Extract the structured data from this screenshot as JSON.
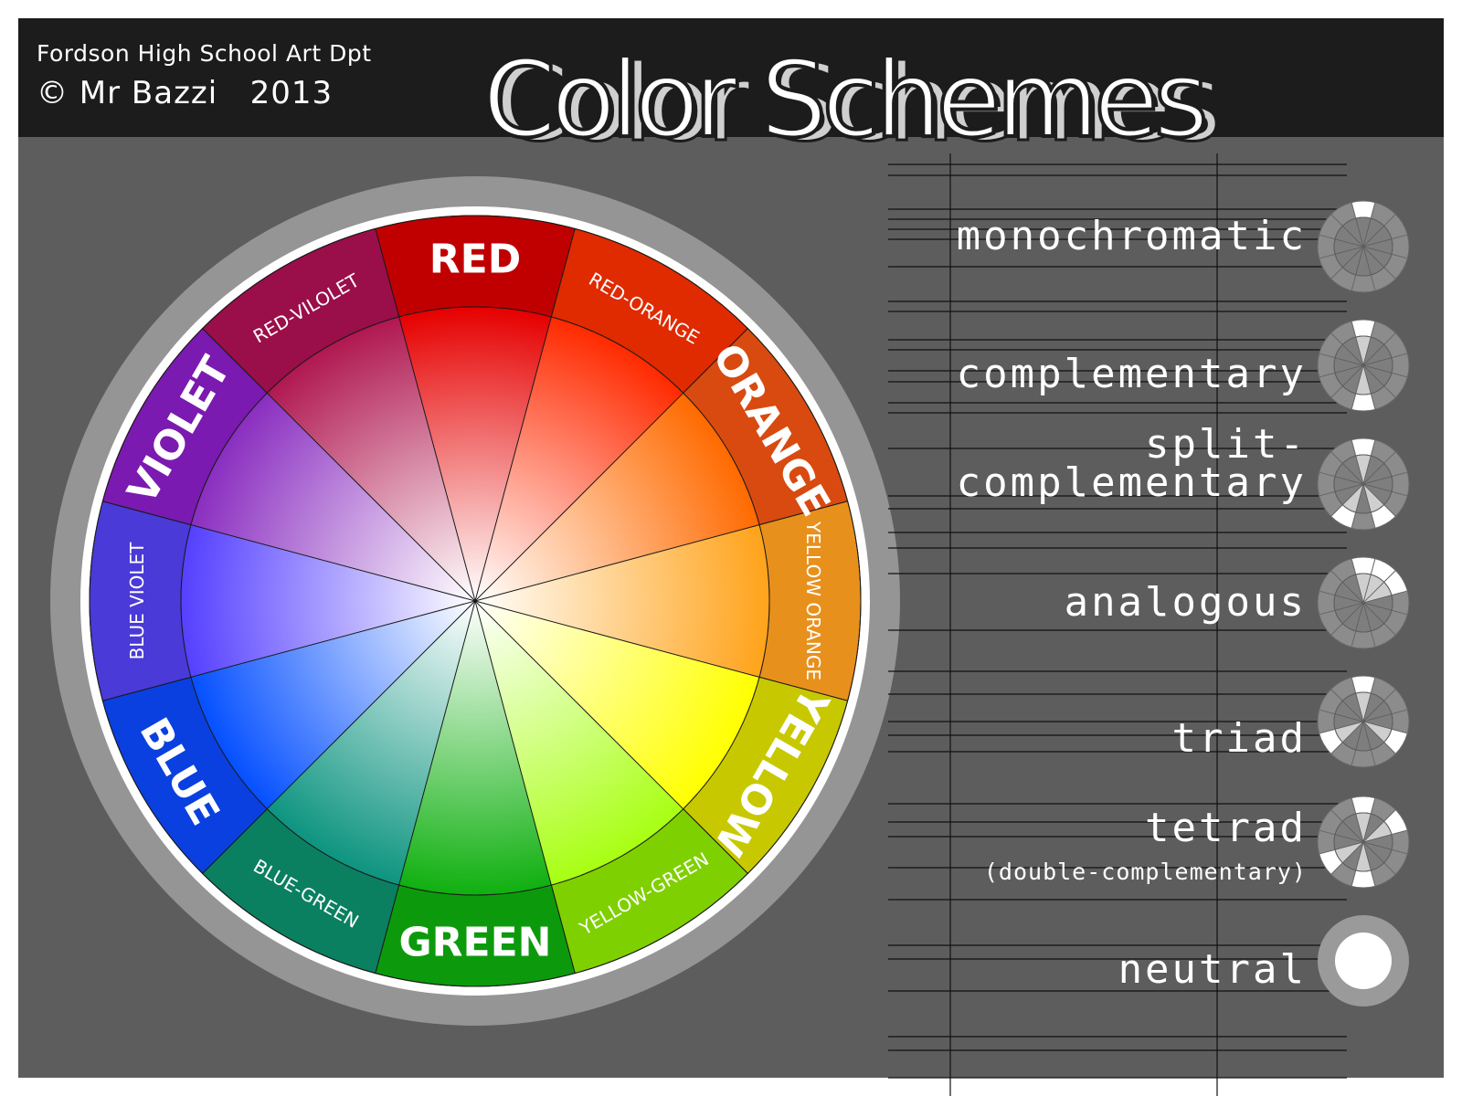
{
  "header": {
    "credit_line_1": "Fordson High School Art Dpt",
    "credit_line_2": "© Mr Bazzi   2013",
    "title": "Color Schemes"
  },
  "color_wheel": {
    "segments": [
      {
        "label": "RED",
        "primary": true,
        "ring_color": "#c00000",
        "inner_color": "#e60000"
      },
      {
        "label": "RED-ORANGE",
        "primary": false,
        "ring_color": "#e02a00",
        "inner_color": "#ff2a00"
      },
      {
        "label": "ORANGE",
        "primary": true,
        "ring_color": "#d84a10",
        "inner_color": "#ff6a00"
      },
      {
        "label": "YELLOW ORANGE",
        "primary": false,
        "ring_color": "#e8901c",
        "inner_color": "#ffa31a"
      },
      {
        "label": "YELLOW",
        "primary": true,
        "ring_color": "#c8c800",
        "inner_color": "#ffff00"
      },
      {
        "label": "YELLOW-GREEN",
        "primary": false,
        "ring_color": "#7fd000",
        "inner_color": "#a8ff12"
      },
      {
        "label": "GREEN",
        "primary": true,
        "ring_color": "#0c9a0c",
        "inner_color": "#10b010"
      },
      {
        "label": "BLUE-GREEN",
        "primary": false,
        "ring_color": "#0a8060",
        "inner_color": "#0d9480"
      },
      {
        "label": "BLUE",
        "primary": true,
        "ring_color": "#0a40e0",
        "inner_color": "#0550ff"
      },
      {
        "label": "BLUE VIOLET",
        "primary": false,
        "ring_color": "#4a3ad8",
        "inner_color": "#5540ff"
      },
      {
        "label": "VIOLET",
        "primary": true,
        "ring_color": "#7a1ab0",
        "inner_color": "#8a2ec0"
      },
      {
        "label": "RED-VILOLET",
        "primary": false,
        "ring_color": "#9a0e4a",
        "inner_color": "#b01850"
      }
    ]
  },
  "schemes": [
    {
      "label": "monochromatic",
      "highlight": [
        0
      ]
    },
    {
      "label": "complementary",
      "highlight": [
        0,
        6
      ]
    },
    {
      "label": "split-\ncomplementary",
      "highlight": [
        0,
        5,
        7
      ]
    },
    {
      "label": "analogous",
      "highlight": [
        0,
        1,
        2
      ]
    },
    {
      "label": "triad",
      "highlight": [
        0,
        4,
        8
      ]
    },
    {
      "label": "tetrad",
      "sublabel": "(double-complementary)",
      "highlight": [
        0,
        2,
        6,
        8
      ]
    },
    {
      "label": "neutral",
      "highlight": []
    }
  ]
}
